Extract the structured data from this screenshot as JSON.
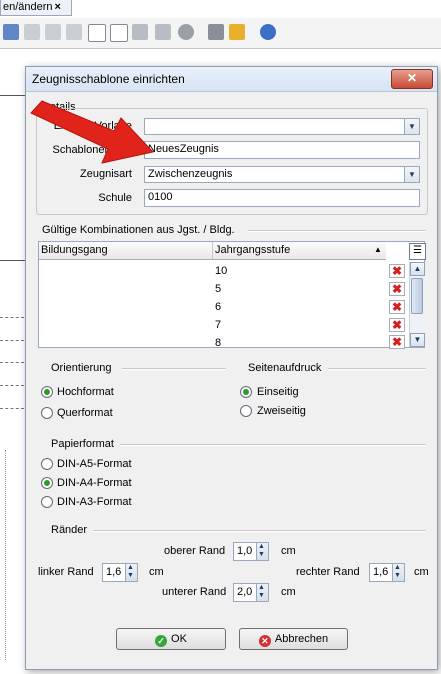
{
  "background": {
    "tab_label": "en/ändern",
    "tab_close": "×"
  },
  "dialog": {
    "title": "Zeugnisschablone einrichten",
    "close_glyph": "✕",
    "details": {
      "section": "Details",
      "externe_label": "Externe Vorlage",
      "externe_value": "",
      "schablonenname_label": "Schablonenna...",
      "schablonenname_value": "NeuesZeugnis",
      "zeugnisart_label": "Zeugnisart",
      "zeugnisart_value": "Zwischenzeugnis",
      "schule_label": "Schule",
      "schule_value": "0100"
    },
    "kombinationen": {
      "section": "Gültige Kombinationen aus Jgst. / Bldg.",
      "col_bildungsgang": "Bildungsgang",
      "col_jahrgangsstufe": "Jahrgangsstufe",
      "rows": [
        {
          "bildungsgang": "",
          "jgst": "10"
        },
        {
          "bildungsgang": "",
          "jgst": "5"
        },
        {
          "bildungsgang": "",
          "jgst": "6"
        },
        {
          "bildungsgang": "",
          "jgst": "7"
        },
        {
          "bildungsgang": "",
          "jgst": "8"
        }
      ],
      "delete_glyph": "✖"
    },
    "orientierung": {
      "section": "Orientierung",
      "options": [
        "Hochformat",
        "Querformat"
      ],
      "selected": "Hochformat"
    },
    "seitenaufdruck": {
      "section": "Seitenaufdruck",
      "options": [
        "Einseitig",
        "Zweiseitig"
      ],
      "selected": "Einseitig"
    },
    "papierformat": {
      "section": "Papierformat",
      "options": [
        "DIN-A5-Format",
        "DIN-A4-Format",
        "DIN-A3-Format"
      ],
      "selected": "DIN-A4-Format"
    },
    "raender": {
      "section": "Ränder",
      "oben_label": "oberer Rand",
      "oben_value": "1,0",
      "links_label": "linker Rand",
      "links_value": "1,6",
      "rechts_label": "rechter Rand",
      "rechts_value": "1,6",
      "unten_label": "unterer Rand",
      "unten_value": "2,0",
      "unit": "cm"
    },
    "buttons": {
      "ok": "OK",
      "cancel": "Abbrechen"
    }
  },
  "colors": {
    "accent_red": "#e0241b",
    "ok_green": "#36a43a",
    "radio_green": "#2b9a2b"
  }
}
